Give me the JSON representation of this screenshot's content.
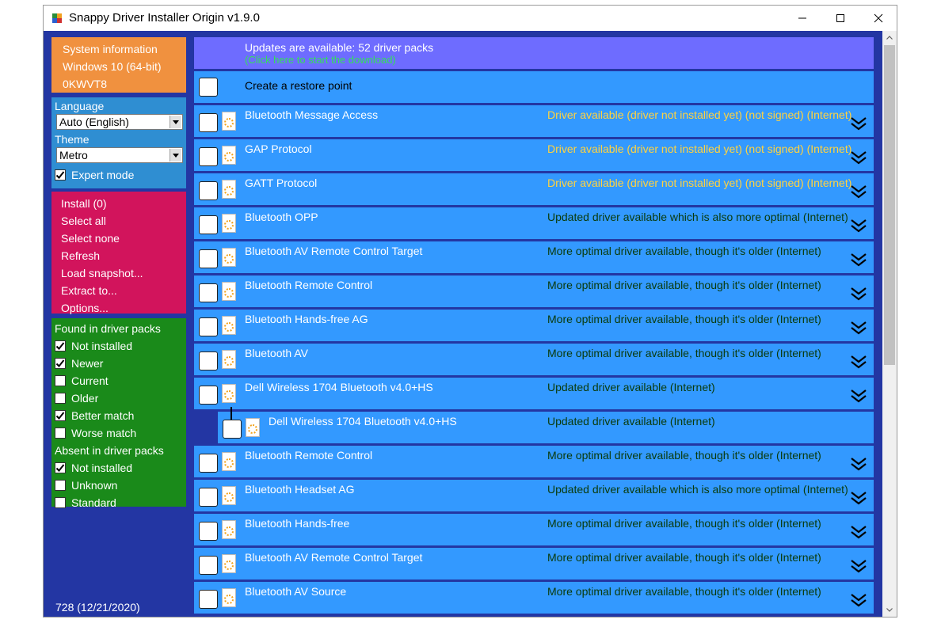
{
  "window": {
    "title": "Snappy Driver Installer Origin v1.9.0",
    "icon": "app-icon",
    "controls": [
      "minimize-icon",
      "maximize-icon",
      "close-icon"
    ]
  },
  "colors": {
    "client_bg": "#2336a3",
    "sysinfo": "#f0913f",
    "language": "#2f8ed2",
    "actions": "#d2145c",
    "filters": "#1a8a1a",
    "row": "#3399ff",
    "banner": "#6e6cff",
    "status_yellow": "#ffd23f",
    "status_green": "#0a3a0a",
    "link_green": "#34e05a"
  },
  "sidebar": {
    "system_info": [
      "System information",
      "Windows 10 (64-bit)",
      "0KWVT8"
    ],
    "language_label": "Language",
    "language_value": "Auto (English)",
    "theme_label": "Theme",
    "theme_value": "Metro",
    "expert_mode": {
      "label": "Expert mode",
      "checked": true
    },
    "actions": [
      "Install (0)",
      "Select all",
      "Select none",
      "Refresh",
      "Load snapshot...",
      "Extract to...",
      "Options..."
    ],
    "found_header": "Found in driver packs",
    "found_filters": [
      {
        "label": "Not installed",
        "checked": true
      },
      {
        "label": "Newer",
        "checked": true
      },
      {
        "label": "Current",
        "checked": false
      },
      {
        "label": "Older",
        "checked": false
      },
      {
        "label": "Better match",
        "checked": true
      },
      {
        "label": "Worse match",
        "checked": false
      }
    ],
    "absent_header": "Absent in driver packs",
    "absent_filters": [
      {
        "label": "Not installed",
        "checked": true
      },
      {
        "label": "Unknown",
        "checked": false
      },
      {
        "label": "Standard",
        "checked": false
      }
    ],
    "version": "728 (12/21/2020)"
  },
  "banner": {
    "title": "Updates are available: 52 driver packs",
    "link": "(Click here to start the download)"
  },
  "restore_point": "Create a restore point",
  "drivers": [
    {
      "name": "Bluetooth Message Access",
      "status": "Driver available (driver not installed yet) (not signed) (Internet)",
      "tone": "yellow"
    },
    {
      "name": "GAP Protocol",
      "status": "Driver available (driver not installed yet) (not signed) (Internet)",
      "tone": "yellow"
    },
    {
      "name": "GATT Protocol",
      "status": "Driver available (driver not installed yet) (not signed) (Internet)",
      "tone": "yellow"
    },
    {
      "name": "Bluetooth OPP",
      "status": "Updated driver available which is also more optimal (Internet)",
      "tone": "green"
    },
    {
      "name": "Bluetooth AV Remote Control Target",
      "status": "More optimal driver available, though it's older (Internet)",
      "tone": "green"
    },
    {
      "name": "Bluetooth Remote Control",
      "status": "More optimal driver available, though it's older (Internet)",
      "tone": "green"
    },
    {
      "name": "Bluetooth Hands-free AG",
      "status": "More optimal driver available, though it's older (Internet)",
      "tone": "green"
    },
    {
      "name": "Bluetooth AV",
      "status": "More optimal driver available, though it's older (Internet)",
      "tone": "green"
    },
    {
      "name": "Dell Wireless 1704 Bluetooth v4.0+HS",
      "status": "Updated driver available (Internet)",
      "tone": "green"
    },
    {
      "name": "Dell Wireless 1704 Bluetooth v4.0+HS",
      "status": "Updated driver available (Internet)",
      "tone": "green",
      "child": true
    },
    {
      "name": "Bluetooth Remote Control",
      "status": "More optimal driver available, though it's older (Internet)",
      "tone": "green"
    },
    {
      "name": "Bluetooth Headset AG",
      "status": "Updated driver available which is also more optimal (Internet)",
      "tone": "green"
    },
    {
      "name": "Bluetooth Hands-free",
      "status": "More optimal driver available, though it's older (Internet)",
      "tone": "green"
    },
    {
      "name": "Bluetooth AV Remote Control Target",
      "status": "More optimal driver available, though it's older (Internet)",
      "tone": "green"
    },
    {
      "name": "Bluetooth AV Source",
      "status": "More optimal driver available, though it's older (Internet)",
      "tone": "green"
    }
  ]
}
